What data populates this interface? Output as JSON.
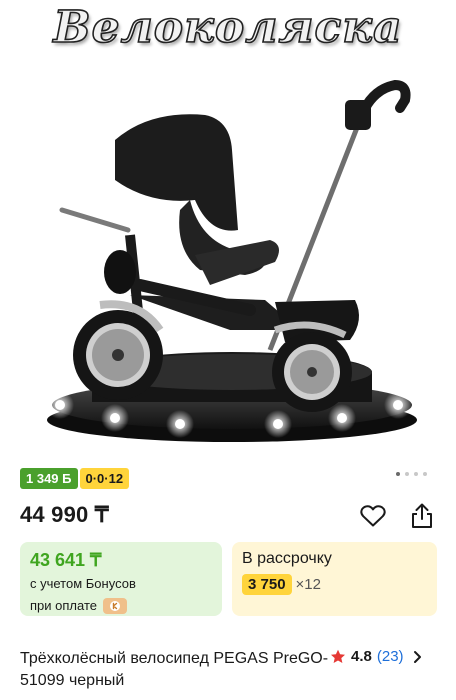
{
  "hero": {
    "title": "Велоколяска",
    "gallery_dots": 4,
    "active_dot": 0
  },
  "badges": {
    "bonus": "1 349 Б",
    "installment": "0·0·12"
  },
  "price": {
    "value": "44 990 ₸"
  },
  "bonus_card": {
    "price": "43 641 ₸",
    "note": "с учетом Бонусов",
    "pay_note": "при оплате"
  },
  "installment_card": {
    "label": "В рассрочку",
    "amount": "3 750",
    "months": "×12"
  },
  "product": {
    "title": "Трёхколёсный велосипед PEGAS PreGO-51099 черный"
  },
  "rating": {
    "value": "4.8",
    "count": "(23)"
  },
  "icons": {
    "favorite": "heart-icon",
    "share": "share-icon",
    "rating": "star-icon",
    "more": "chevron-right-icon",
    "payment": "kaspi-icon"
  },
  "colors": {
    "bonus_green": "#4aa02c",
    "bonus_card_bg": "#e3f5db",
    "bonus_price": "#3fa51f",
    "installment_yellow": "#ffd43b",
    "installment_card_bg": "#fff6d6",
    "star": "#e53935",
    "link_blue": "#1e6fd9"
  }
}
